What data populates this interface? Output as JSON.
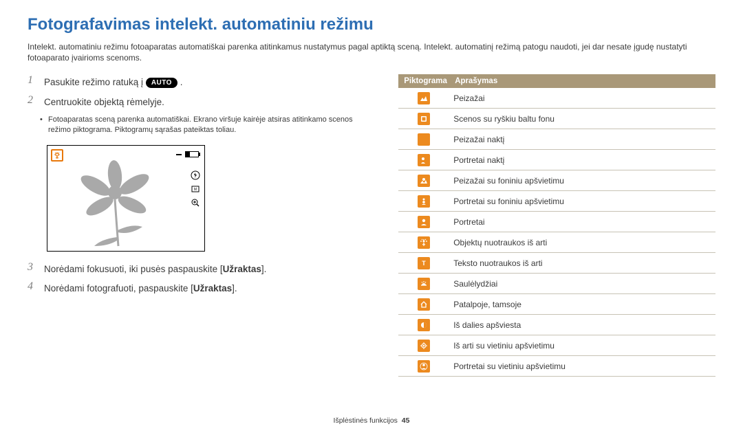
{
  "title": "Fotografavimas intelekt. automatiniu režimu",
  "intro": "Intelekt. automatiniu režimu fotoaparatas automatiškai parenka atitinkamus nustatymus pagal aptiktą sceną. Intelekt. automatinį režimą patogu naudoti, jei dar nesate įgudę nustatyti fotoaparato įvairioms scenoms.",
  "steps": {
    "s1_pre": "Pasukite režimo ratuką į ",
    "s1_auto": "AUTO",
    "s1_post": " .",
    "s2": "Centruokite objektą rėmelyje.",
    "s2_bullet": "Fotoaparatas sceną parenka automatiškai. Ekrano viršuje kairėje atsiras atitinkamo scenos režimo piktograma. Piktogramų sąrašas pateiktas toliau.",
    "s3_pre": "Norėdami fokusuoti, iki pusės paspauskite [",
    "s3_bold": "Užraktas",
    "s3_post": "].",
    "s4_pre": "Norėdami fotografuoti, paspauskite [",
    "s4_bold": "Užraktas",
    "s4_post": "]."
  },
  "table": {
    "h1": "Piktograma",
    "h2": "Aprašymas",
    "rows": [
      {
        "icon": "landscape",
        "style": "filled",
        "label": "Peizažai"
      },
      {
        "icon": "white",
        "style": "filled",
        "label": "Scenos su ryškiu baltu fonu"
      },
      {
        "icon": "night-land",
        "style": "filled",
        "label": "Peizažai naktį"
      },
      {
        "icon": "night-portrait",
        "style": "filled",
        "label": "Portretai naktį"
      },
      {
        "icon": "backlight-land",
        "style": "filled",
        "label": "Peizažai su foniniu apšvietimu"
      },
      {
        "icon": "backlight-portrait",
        "style": "filled",
        "label": "Portretai su foniniu apšvietimu"
      },
      {
        "icon": "portrait",
        "style": "filled",
        "label": "Portretai"
      },
      {
        "icon": "macro",
        "style": "filled",
        "label": "Objektų nuotraukos iš arti"
      },
      {
        "icon": "text",
        "style": "filled",
        "label": "Teksto nuotraukos iš arti"
      },
      {
        "icon": "sunset",
        "style": "filled",
        "label": "Saulėlydžiai"
      },
      {
        "icon": "indoor",
        "style": "filled",
        "label": "Patalpoje, tamsoje"
      },
      {
        "icon": "partial",
        "style": "filled",
        "label": "Iš dalies apšviesta"
      },
      {
        "icon": "spot-macro",
        "style": "filled",
        "label": "Iš arti su vietiniu apšvietimu"
      },
      {
        "icon": "spot-portrait",
        "style": "filled",
        "label": "Portretai su vietiniu apšvietimu"
      }
    ]
  },
  "footer": {
    "section": "Išplėstinės funkcijos",
    "page": "45"
  }
}
